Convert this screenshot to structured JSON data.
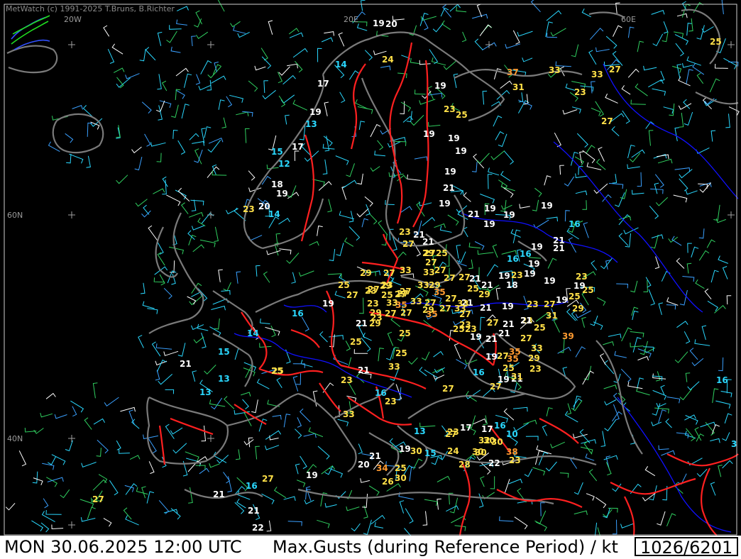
{
  "header": {
    "credit": "MetWatch  (c) 1991-2025 T.Bruns, B.Richter"
  },
  "footer": {
    "datetime": "MON 30.06.2025 12:00 UTC",
    "title": "Max.Gusts (during Reference Period) / kt",
    "count": "1026/6201"
  },
  "axis_labels": [
    "20W",
    "20E",
    "60E",
    "60N",
    "40N"
  ],
  "colors": {
    "background": "#000000",
    "coastline": "#7a7a7a",
    "border": "#ff2020",
    "river": "#1010ff",
    "gust_low": "#2ad8ff",
    "gust_mid": "#ffffff",
    "gust_high": "#ffe048",
    "gust_vhigh": "#ff9a30"
  },
  "gust_observations": [
    {
      "v": "19"
    },
    {
      "v": "20"
    },
    {
      "v": "24"
    },
    {
      "v": "14"
    },
    {
      "v": "17"
    },
    {
      "v": "19"
    },
    {
      "v": "13"
    },
    {
      "v": "17"
    },
    {
      "v": "15"
    },
    {
      "v": "12"
    },
    {
      "v": "18"
    },
    {
      "v": "19"
    },
    {
      "v": "23"
    },
    {
      "v": "20"
    },
    {
      "v": "14"
    },
    {
      "v": "37"
    },
    {
      "v": "33"
    },
    {
      "v": "33"
    },
    {
      "v": "27"
    },
    {
      "v": "31"
    },
    {
      "v": "23"
    },
    {
      "v": "25"
    },
    {
      "v": "27"
    },
    {
      "v": "19"
    },
    {
      "v": "23"
    },
    {
      "v": "25"
    },
    {
      "v": "19"
    },
    {
      "v": "19"
    },
    {
      "v": "19"
    },
    {
      "v": "19"
    },
    {
      "v": "21"
    },
    {
      "v": "19"
    },
    {
      "v": "21"
    },
    {
      "v": "19"
    },
    {
      "v": "19"
    },
    {
      "v": "19"
    },
    {
      "v": "19"
    },
    {
      "v": "16"
    },
    {
      "v": "23"
    },
    {
      "v": "21"
    },
    {
      "v": "27"
    },
    {
      "v": "21"
    },
    {
      "v": "27"
    },
    {
      "v": "29"
    },
    {
      "v": "25"
    },
    {
      "v": "27"
    },
    {
      "v": "16"
    },
    {
      "v": "19"
    },
    {
      "v": "21"
    },
    {
      "v": "21"
    },
    {
      "v": "16"
    },
    {
      "v": "19"
    },
    {
      "v": "27"
    },
    {
      "v": "33"
    },
    {
      "v": "33"
    },
    {
      "v": "27"
    },
    {
      "v": "29"
    },
    {
      "v": "27"
    },
    {
      "v": "19"
    },
    {
      "v": "23"
    },
    {
      "v": "19"
    },
    {
      "v": "23"
    },
    {
      "v": "25"
    },
    {
      "v": "29"
    },
    {
      "v": "33"
    },
    {
      "v": "23"
    },
    {
      "v": "27"
    },
    {
      "v": "21"
    },
    {
      "v": "21"
    },
    {
      "v": "18"
    },
    {
      "v": "19"
    },
    {
      "v": "19"
    },
    {
      "v": "25"
    },
    {
      "v": "23"
    },
    {
      "v": "27"
    },
    {
      "v": "29"
    },
    {
      "v": "27"
    },
    {
      "v": "25"
    },
    {
      "v": "27"
    },
    {
      "v": "35"
    },
    {
      "v": "33"
    },
    {
      "v": "27"
    },
    {
      "v": "27"
    },
    {
      "v": "25"
    },
    {
      "v": "29"
    },
    {
      "v": "21"
    },
    {
      "v": "27"
    },
    {
      "v": "19"
    },
    {
      "v": "25"
    },
    {
      "v": "19"
    },
    {
      "v": "23"
    },
    {
      "v": "33"
    },
    {
      "v": "35"
    },
    {
      "v": "33"
    },
    {
      "v": "27"
    },
    {
      "v": "27"
    },
    {
      "v": "23"
    },
    {
      "v": "29"
    },
    {
      "v": "35"
    },
    {
      "v": "21"
    },
    {
      "v": "27"
    },
    {
      "v": "33"
    },
    {
      "v": "27"
    },
    {
      "v": "19"
    },
    {
      "v": "16"
    },
    {
      "v": "23"
    },
    {
      "v": "29"
    },
    {
      "v": "27"
    },
    {
      "v": "29"
    },
    {
      "v": "27"
    },
    {
      "v": "29"
    },
    {
      "v": "21"
    },
    {
      "v": "31"
    },
    {
      "v": "23"
    },
    {
      "v": "27"
    },
    {
      "v": "21"
    },
    {
      "v": "25"
    },
    {
      "v": "21"
    },
    {
      "v": "23"
    },
    {
      "v": "25"
    },
    {
      "v": "14"
    },
    {
      "v": "25"
    },
    {
      "v": "23"
    },
    {
      "v": "25"
    },
    {
      "v": "19"
    },
    {
      "v": "21"
    },
    {
      "v": "21"
    },
    {
      "v": "27"
    },
    {
      "v": "33"
    },
    {
      "v": "39"
    },
    {
      "v": "15"
    },
    {
      "v": "35"
    },
    {
      "v": "25"
    },
    {
      "v": "19"
    },
    {
      "v": "27"
    },
    {
      "v": "35"
    },
    {
      "v": "33"
    },
    {
      "v": "21"
    },
    {
      "v": "25"
    },
    {
      "v": "16"
    },
    {
      "v": "23"
    },
    {
      "v": "25"
    },
    {
      "v": "21"
    },
    {
      "v": "29"
    },
    {
      "v": "27"
    },
    {
      "v": "13"
    },
    {
      "v": "23"
    },
    {
      "v": "19"
    },
    {
      "v": "31"
    },
    {
      "v": "13"
    },
    {
      "v": "16"
    },
    {
      "v": "23"
    },
    {
      "v": "27"
    },
    {
      "v": "16"
    },
    {
      "v": "33"
    },
    {
      "v": "27"
    },
    {
      "v": "23"
    },
    {
      "v": "17"
    },
    {
      "v": "17"
    },
    {
      "v": "16"
    },
    {
      "v": "10"
    },
    {
      "v": "30"
    },
    {
      "v": "32"
    },
    {
      "v": "30"
    },
    {
      "v": "13"
    },
    {
      "v": "19"
    },
    {
      "v": "30"
    },
    {
      "v": "15"
    },
    {
      "v": "24"
    },
    {
      "v": "30"
    },
    {
      "v": "38"
    },
    {
      "v": "21"
    },
    {
      "v": "20"
    },
    {
      "v": "34"
    },
    {
      "v": "25"
    },
    {
      "v": "28"
    },
    {
      "v": "30"
    },
    {
      "v": "22"
    },
    {
      "v": "23"
    },
    {
      "v": "30"
    },
    {
      "v": "26"
    },
    {
      "v": "27"
    },
    {
      "v": "19"
    },
    {
      "v": "16"
    },
    {
      "v": "21"
    },
    {
      "v": "21"
    },
    {
      "v": "27"
    },
    {
      "v": "22"
    },
    {
      "v": "3"
    },
    {
      "v": "25"
    },
    {
      "v": "21"
    }
  ]
}
